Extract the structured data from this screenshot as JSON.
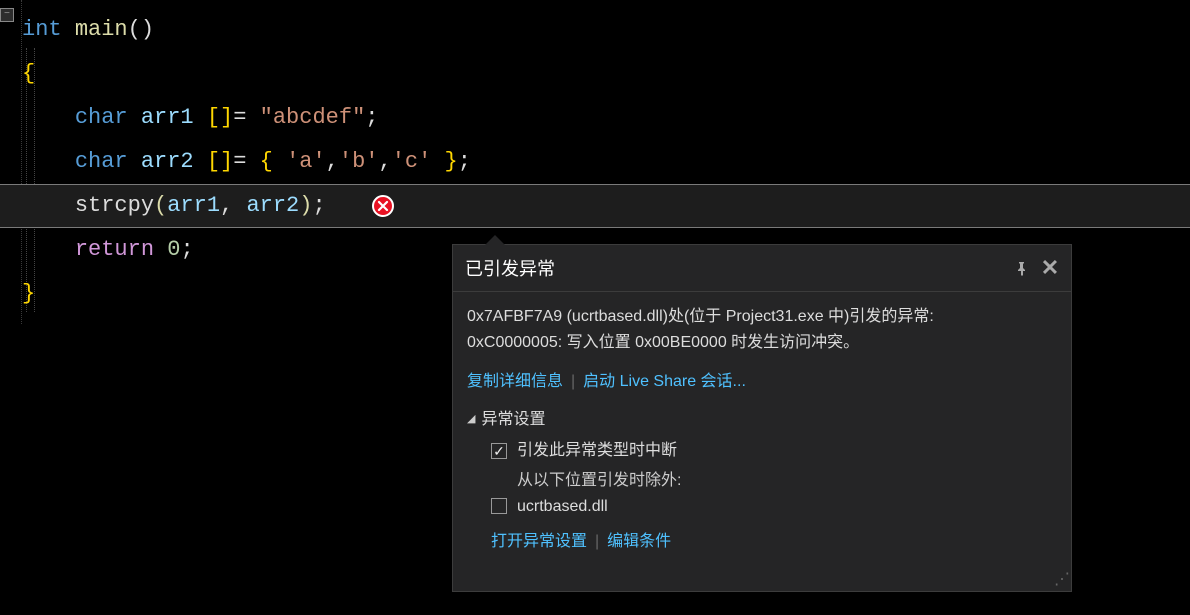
{
  "code": {
    "line1": {
      "type": "int",
      "fn": "main"
    },
    "line2": {
      "brace_open": "{"
    },
    "line3": {
      "type": "char",
      "var": "arr1",
      "brackets": "[]",
      "eq": "=",
      "str": "\"abcdef\""
    },
    "line4": {
      "type": "char",
      "var": "arr2",
      "brackets": "[]",
      "eq": "=",
      "chars": [
        "'a'",
        "'b'",
        "'c'"
      ]
    },
    "line5": {
      "fn": "strcpy",
      "arg1": "arr1",
      "arg2": "arr2"
    },
    "line6": {
      "kw": "return",
      "val": "0"
    },
    "line7": {
      "brace_close": "}"
    }
  },
  "popup": {
    "title": "已引发异常",
    "message_line1": "0x7AFBF7A9 (ucrtbased.dll)处(位于 Project31.exe 中)引发的异常:",
    "message_line2": "0xC0000005: 写入位置 0x00BE0000 时发生访问冲突。",
    "link_copy": "复制详细信息",
    "link_live_share": "启动 Live Share 会话...",
    "settings_label": "异常设置",
    "checkbox_break": "引发此异常类型时中断",
    "exclude_label": "从以下位置引发时除外:",
    "exclude_item": "ucrtbased.dll",
    "link_open_settings": "打开异常设置",
    "link_edit_conditions": "编辑条件"
  }
}
